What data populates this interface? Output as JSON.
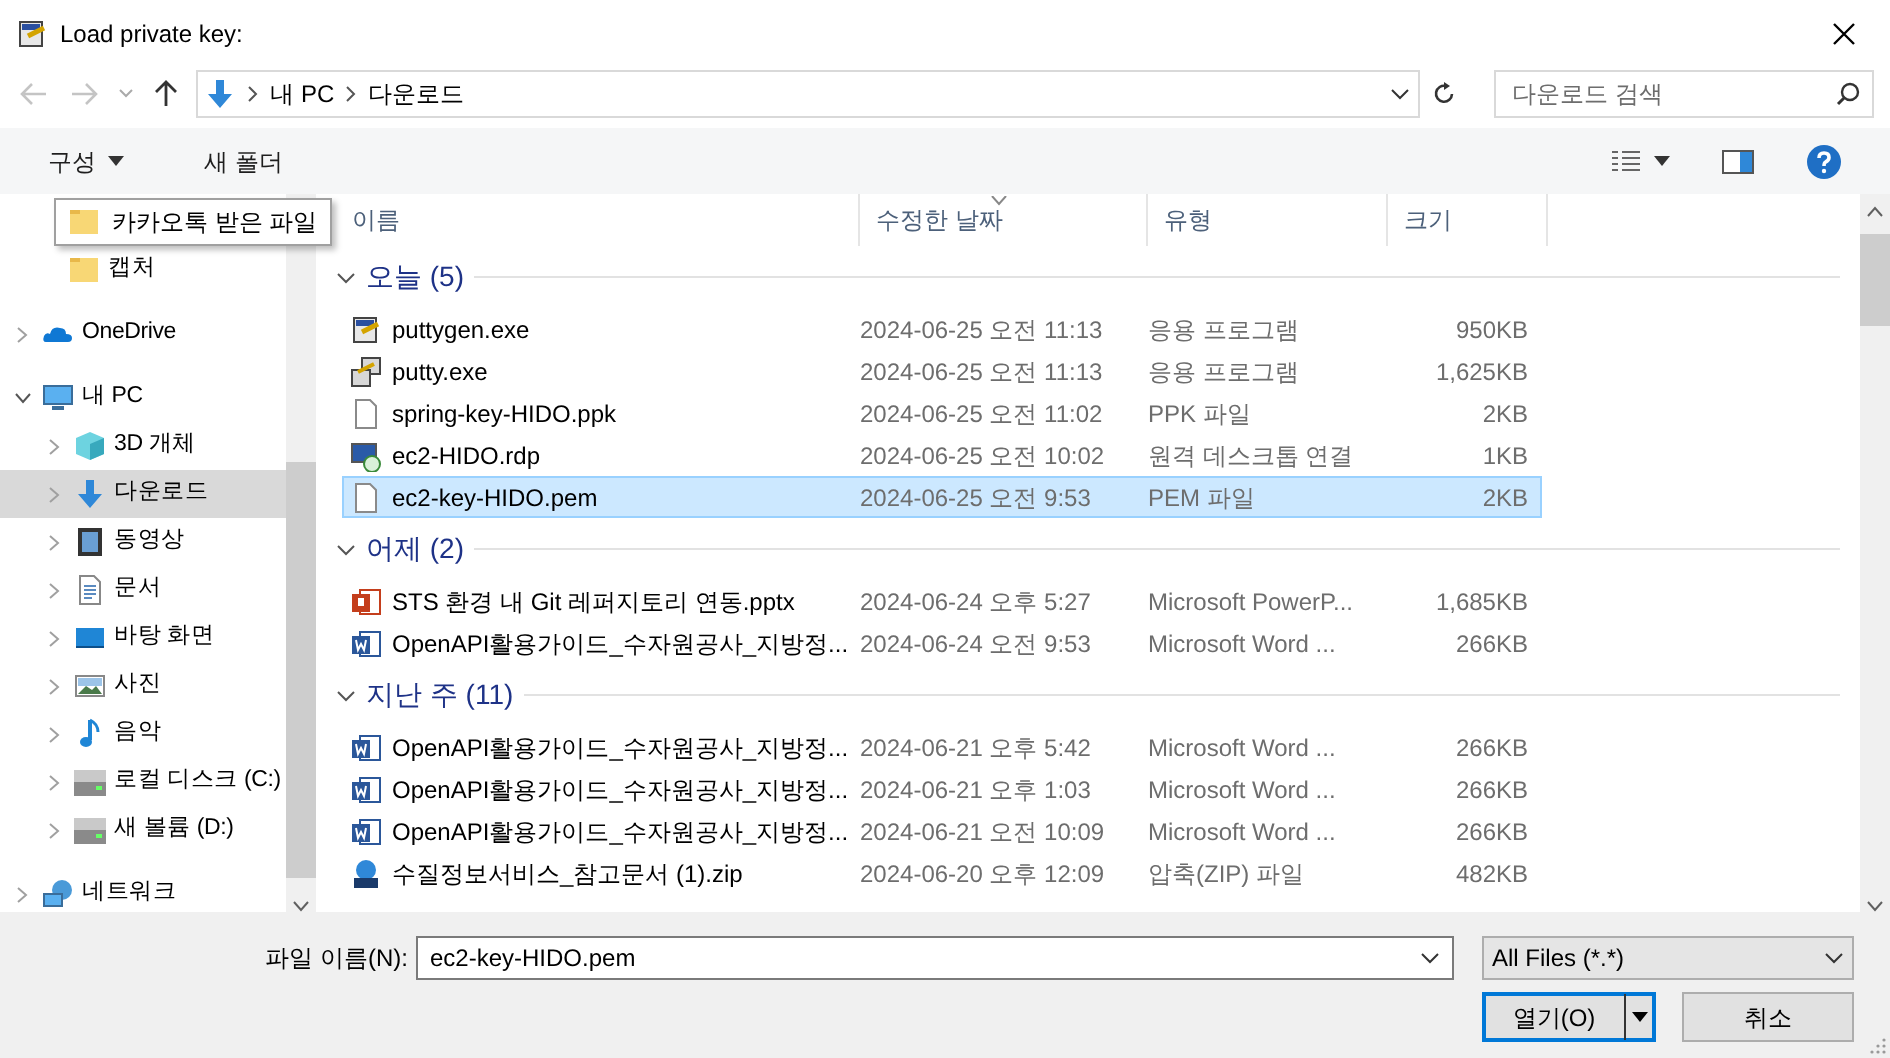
{
  "window": {
    "title": "Load private key:"
  },
  "address_bar": {
    "back_disabled": true,
    "forward_disabled": true,
    "path": [
      "내 PC",
      "다운로드"
    ],
    "search_placeholder": "다운로드 검색"
  },
  "toolbar": {
    "organize": "구성",
    "new_folder": "새 폴더"
  },
  "sidebar": {
    "pinned_items": [
      {
        "label": "카카오톡 받은 파일",
        "kind": "folder",
        "tooltip": true
      },
      {
        "label": "캡처",
        "kind": "folder",
        "tooltip": false
      }
    ],
    "tree": [
      {
        "label": "OneDrive",
        "kind": "cloud",
        "expanded": false,
        "selected": false
      },
      {
        "label": "내 PC",
        "kind": "pc",
        "expanded": true,
        "selected": false,
        "children": [
          {
            "label": "3D 개체",
            "kind": "cube",
            "expanded": false,
            "selected": false
          },
          {
            "label": "다운로드",
            "kind": "download",
            "expanded": false,
            "selected": true
          },
          {
            "label": "동영상",
            "kind": "video",
            "expanded": false,
            "selected": false
          },
          {
            "label": "문서",
            "kind": "document",
            "expanded": false,
            "selected": false
          },
          {
            "label": "바탕 화면",
            "kind": "desktop",
            "expanded": false,
            "selected": false
          },
          {
            "label": "사진",
            "kind": "photo",
            "expanded": false,
            "selected": false
          },
          {
            "label": "음악",
            "kind": "music",
            "expanded": false,
            "selected": false
          },
          {
            "label": "로컬 디스크 (C:)",
            "kind": "drive",
            "expanded": false,
            "selected": false
          },
          {
            "label": "새 볼륨 (D:)",
            "kind": "drive",
            "expanded": false,
            "selected": false
          }
        ]
      },
      {
        "label": "네트워크",
        "kind": "network",
        "expanded": false,
        "selected": false
      }
    ]
  },
  "file_list": {
    "columns": [
      {
        "label": "이름",
        "sorted": false
      },
      {
        "label": "수정한 날짜",
        "sorted": true
      },
      {
        "label": "유형",
        "sorted": false
      },
      {
        "label": "크기",
        "sorted": false
      }
    ],
    "groups": [
      {
        "label": "오늘 (5)",
        "expanded": true,
        "files": [
          {
            "name": "puttygen.exe",
            "date": "2024-06-25 오전 11:13",
            "type": "응용 프로그램",
            "size": "950KB",
            "kind": "keygen",
            "selected": false
          },
          {
            "name": "putty.exe",
            "date": "2024-06-25 오전 11:13",
            "type": "응용 프로그램",
            "size": "1,625KB",
            "kind": "putty",
            "selected": false
          },
          {
            "name": "spring-key-HIDO.ppk",
            "date": "2024-06-25 오전 11:02",
            "type": "PPK 파일",
            "size": "2KB",
            "kind": "file",
            "selected": false
          },
          {
            "name": "ec2-HIDO.rdp",
            "date": "2024-06-25 오전 10:02",
            "type": "원격 데스크톱 연결",
            "size": "1KB",
            "kind": "rdp",
            "selected": false
          },
          {
            "name": "ec2-key-HIDO.pem",
            "date": "2024-06-25 오전 9:53",
            "type": "PEM 파일",
            "size": "2KB",
            "kind": "file",
            "selected": true
          }
        ]
      },
      {
        "label": "어제 (2)",
        "expanded": true,
        "files": [
          {
            "name": "STS 환경 내 Git 레퍼지토리 연동.pptx",
            "date": "2024-06-24 오후 5:27",
            "type": "Microsoft PowerP...",
            "size": "1,685KB",
            "kind": "pptx",
            "selected": false
          },
          {
            "name": "OpenAPI활용가이드_수자원공사_지방정...",
            "date": "2024-06-24 오전 9:53",
            "type": "Microsoft Word ...",
            "size": "266KB",
            "kind": "docx",
            "selected": false
          }
        ]
      },
      {
        "label": "지난 주 (11)",
        "expanded": true,
        "files": [
          {
            "name": "OpenAPI활용가이드_수자원공사_지방정...",
            "date": "2024-06-21 오후 5:42",
            "type": "Microsoft Word ...",
            "size": "266KB",
            "kind": "docx",
            "selected": false
          },
          {
            "name": "OpenAPI활용가이드_수자원공사_지방정...",
            "date": "2024-06-21 오후 1:03",
            "type": "Microsoft Word ...",
            "size": "266KB",
            "kind": "docx",
            "selected": false
          },
          {
            "name": "OpenAPI활용가이드_수자원공사_지방정...",
            "date": "2024-06-21 오전 10:09",
            "type": "Microsoft Word ...",
            "size": "266KB",
            "kind": "docx",
            "selected": false
          },
          {
            "name": "수질정보서비스_참고문서 (1).zip",
            "date": "2024-06-20 오후 12:09",
            "type": "압축(ZIP) 파일",
            "size": "482KB",
            "kind": "zip",
            "selected": false
          }
        ]
      }
    ]
  },
  "footer": {
    "filename_label": "파일 이름(N):",
    "filename": "ec2-key-HIDO.pem",
    "filter": "All Files (*.*)",
    "open_button": "열기(O)",
    "cancel_button": "취소"
  }
}
